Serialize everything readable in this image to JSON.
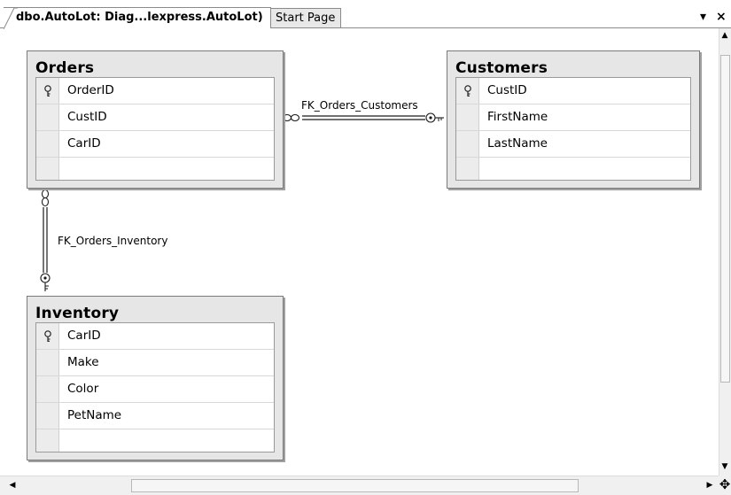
{
  "tabs": {
    "active_label": "dbo.AutoLot: Diag...lexpress.AutoLot)",
    "inactive_label": "Start Page",
    "dropdown_glyph": "▾",
    "close_glyph": "×"
  },
  "diagram": {
    "tables": [
      {
        "title": "Orders",
        "columns": [
          {
            "name": "OrderID",
            "key": true
          },
          {
            "name": "CustID",
            "key": false
          },
          {
            "name": "CarID",
            "key": false
          }
        ]
      },
      {
        "title": "Customers",
        "columns": [
          {
            "name": "CustID",
            "key": true
          },
          {
            "name": "FirstName",
            "key": false
          },
          {
            "name": "LastName",
            "key": false
          }
        ]
      },
      {
        "title": "Inventory",
        "columns": [
          {
            "name": "CarID",
            "key": true
          },
          {
            "name": "Make",
            "key": false
          },
          {
            "name": "Color",
            "key": false
          },
          {
            "name": "PetName",
            "key": false
          }
        ]
      }
    ],
    "relationships": [
      {
        "name": "FK_Orders_Customers"
      },
      {
        "name": "FK_Orders_Inventory"
      }
    ]
  },
  "scrollbars": {
    "up_arrow": "▲",
    "down_arrow": "▼",
    "left_arrow": "◀",
    "right_arrow": "▶",
    "corner_glyph": "✥"
  },
  "colors": {
    "table_background": "#e6e6e6",
    "grid_background": "#ffffff",
    "line_color": "#1a1a1a"
  }
}
